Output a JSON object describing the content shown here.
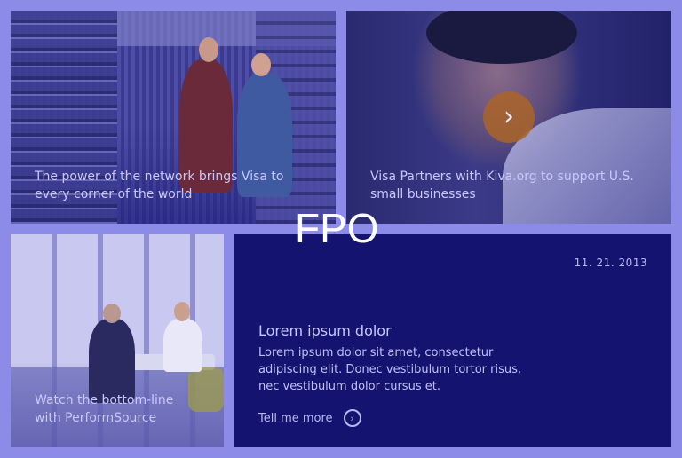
{
  "tiles": {
    "network": {
      "caption": "The power of the network brings Visa to every corner of the world"
    },
    "kiva": {
      "caption": "Visa Partners with Kiva.org to support U.S. small businesses",
      "arrow_icon": "chevron-right-icon"
    },
    "performsource": {
      "caption": "Watch the bottom-line with PerformSource"
    }
  },
  "info": {
    "date": "11. 21. 2013",
    "heading": "Lorem ipsum dolor",
    "body": "Lorem ipsum dolor sit amet, consectetur adipiscing elit. Donec vestibulum tortor risus, nec vestibulum dolor cursus et.",
    "cta": "Tell me more",
    "cta_icon": "circle-chevron-right-icon"
  },
  "placeholder_label": "FPO",
  "colors": {
    "background": "#8c8ce8",
    "panel": "#141470",
    "accent": "#aa6428"
  }
}
